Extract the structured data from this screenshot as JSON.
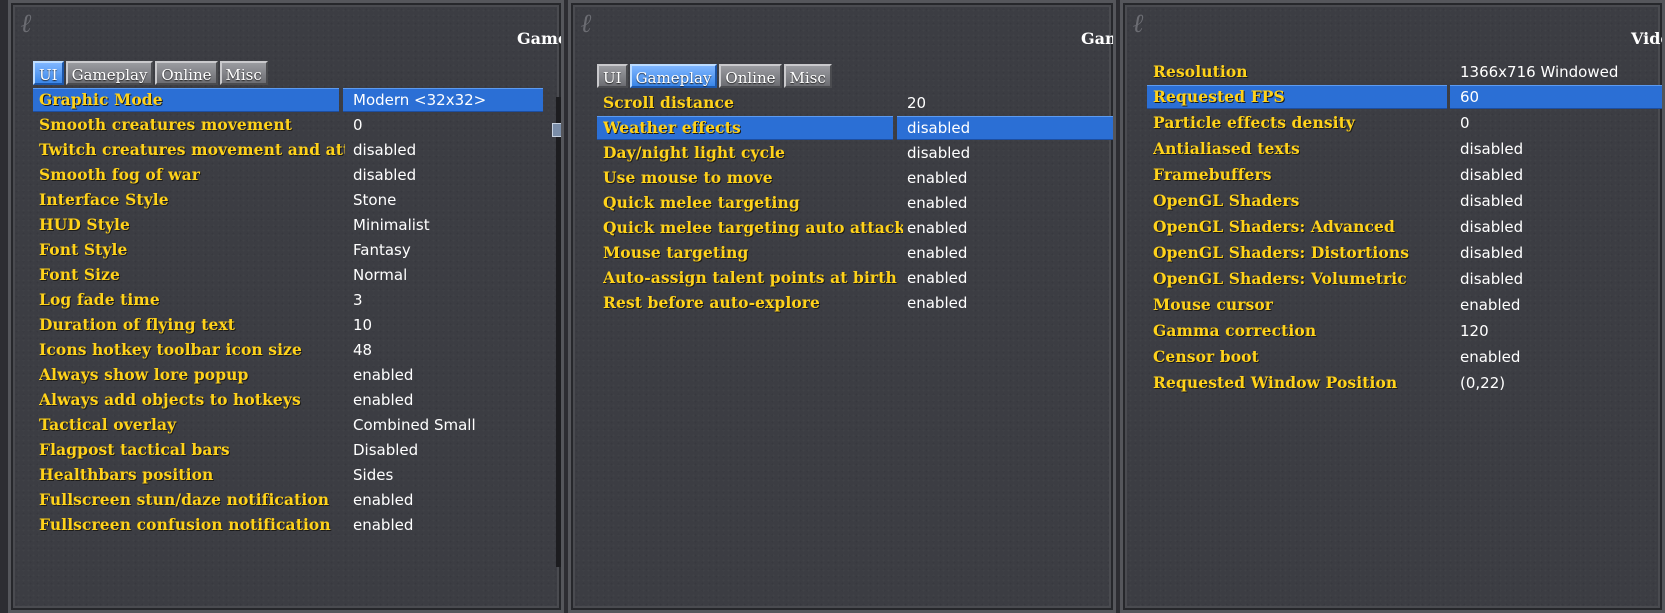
{
  "panels": [
    {
      "title": "Game",
      "tabs": [
        {
          "label": "UI",
          "active": true
        },
        {
          "label": "Gameplay",
          "active": false
        },
        {
          "label": "Online",
          "active": false
        },
        {
          "label": "Misc",
          "active": false
        }
      ],
      "selected_row": 0,
      "rows": [
        {
          "label": "Graphic Mode",
          "value": "Modern <32x32>"
        },
        {
          "label": "Smooth creatures movement",
          "value": "0"
        },
        {
          "label": "Twitch creatures movement and atta",
          "value": "disabled"
        },
        {
          "label": "Smooth fog of war",
          "value": "disabled"
        },
        {
          "label": "Interface Style",
          "value": "Stone"
        },
        {
          "label": "HUD Style",
          "value": "Minimalist"
        },
        {
          "label": "Font Style",
          "value": "Fantasy"
        },
        {
          "label": "Font Size",
          "value": "Normal"
        },
        {
          "label": "Log fade time",
          "value": "3"
        },
        {
          "label": "Duration of flying text",
          "value": "10"
        },
        {
          "label": "Icons hotkey toolbar icon size",
          "value": "48"
        },
        {
          "label": "Always show lore popup",
          "value": "enabled"
        },
        {
          "label": "Always add objects to hotkeys",
          "value": "enabled"
        },
        {
          "label": "Tactical overlay",
          "value": "Combined Small"
        },
        {
          "label": "Flagpost tactical bars",
          "value": "Disabled"
        },
        {
          "label": "Healthbars position",
          "value": "Sides"
        },
        {
          "label": "Fullscreen stun/daze notification",
          "value": "enabled"
        },
        {
          "label": "Fullscreen confusion notification",
          "value": "enabled"
        }
      ]
    },
    {
      "title": "Gam",
      "tabs": [
        {
          "label": "UI",
          "active": false
        },
        {
          "label": "Gameplay",
          "active": true
        },
        {
          "label": "Online",
          "active": false
        },
        {
          "label": "Misc",
          "active": false
        }
      ],
      "selected_row": 1,
      "rows": [
        {
          "label": "Scroll distance",
          "value": "20"
        },
        {
          "label": "Weather effects",
          "value": "disabled"
        },
        {
          "label": "Day/night light cycle",
          "value": "disabled"
        },
        {
          "label": "Use mouse to move",
          "value": "enabled"
        },
        {
          "label": "Quick melee targeting",
          "value": "enabled"
        },
        {
          "label": "Quick melee targeting auto attack",
          "value": "enabled"
        },
        {
          "label": "Mouse targeting",
          "value": "enabled"
        },
        {
          "label": "Auto-assign talent points at birth",
          "value": "enabled"
        },
        {
          "label": "Rest before auto-explore",
          "value": "enabled"
        }
      ]
    },
    {
      "title": "Vide",
      "tabs": [],
      "selected_row": 1,
      "rows": [
        {
          "label": "Resolution",
          "value": "1366x716 Windowed"
        },
        {
          "label": "Requested FPS",
          "value": "60"
        },
        {
          "label": "Particle effects density",
          "value": "0"
        },
        {
          "label": "Antialiased texts",
          "value": "disabled"
        },
        {
          "label": "Framebuffers",
          "value": "disabled"
        },
        {
          "label": "OpenGL Shaders",
          "value": "disabled"
        },
        {
          "label": "OpenGL Shaders: Advanced",
          "value": "disabled"
        },
        {
          "label": "OpenGL Shaders: Distortions",
          "value": "disabled"
        },
        {
          "label": "OpenGL Shaders: Volumetric",
          "value": "disabled"
        },
        {
          "label": "Mouse cursor",
          "value": "enabled"
        },
        {
          "label": "Gamma correction",
          "value": "120"
        },
        {
          "label": "Censor boot",
          "value": "enabled"
        },
        {
          "label": "Requested Window Position",
          "value": "(0,22)"
        }
      ]
    }
  ],
  "colors": {
    "label": "#ffd21a",
    "value": "#ffffff",
    "highlight": "#2b6fd5",
    "panel_bg": "#3c3d43"
  }
}
